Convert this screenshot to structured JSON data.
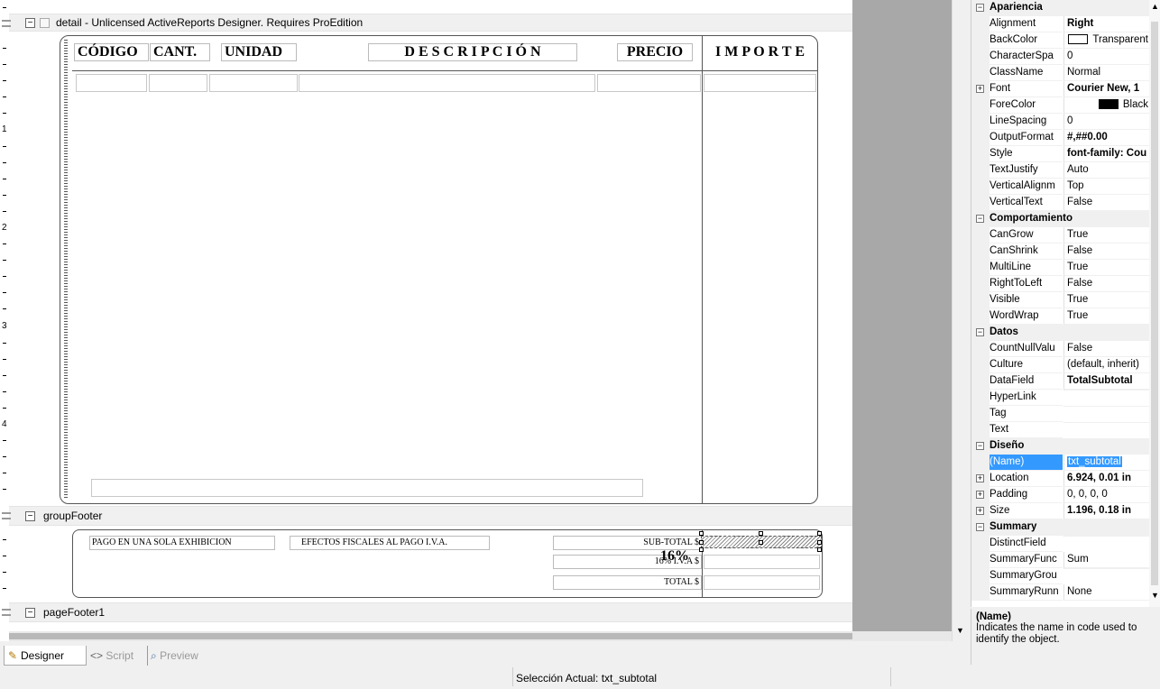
{
  "bands": {
    "detail": {
      "title": "detail  -  Unlicensed ActiveReports Designer. Requires ProEdition"
    },
    "group_footer": {
      "title": "groupFooter"
    },
    "page_footer": {
      "title": "pageFooter1"
    }
  },
  "ruler": {
    "marks": [
      "1",
      "2",
      "3",
      "4"
    ]
  },
  "report": {
    "headers": {
      "codigo": "CÓDIGO",
      "cant": "CANT.",
      "unidad": "UNIDAD",
      "descripcion": "D E S C R I P C I Ó N",
      "precio": "PRECIO",
      "importe": "I M P O R T E"
    },
    "footer": {
      "pago": "PAGO EN UNA SOLA EXHIBICION",
      "efectos": "EFECTOS FISCALES AL PAGO I.V.A.",
      "subtotal": "SUB-TOTAL $",
      "iva": "16% I.V.A $",
      "iva_big": "16%",
      "total": "TOTAL $"
    }
  },
  "properties": {
    "categories": [
      {
        "name": "Apariencia",
        "rows": [
          {
            "name": "Alignment",
            "value": "Right",
            "bold": true
          },
          {
            "name": "BackColor",
            "value": "Transparent",
            "swatch": "#ffffff"
          },
          {
            "name": "CharacterSpa",
            "value": "0"
          },
          {
            "name": "ClassName",
            "value": "Normal"
          },
          {
            "name": "Font",
            "value": "Courier New, 1",
            "bold": true,
            "expand": true
          },
          {
            "name": "ForeColor",
            "value": "Black",
            "swatch": "#000000"
          },
          {
            "name": "LineSpacing",
            "value": "0"
          },
          {
            "name": "OutputFormat",
            "value": "#,##0.00",
            "bold": true
          },
          {
            "name": "Style",
            "value": "font-family: Cou",
            "bold": true
          },
          {
            "name": "TextJustify",
            "value": "Auto"
          },
          {
            "name": "VerticalAlignm",
            "value": "Top"
          },
          {
            "name": "VerticalText",
            "value": "False"
          }
        ]
      },
      {
        "name": "Comportamiento",
        "rows": [
          {
            "name": "CanGrow",
            "value": "True"
          },
          {
            "name": "CanShrink",
            "value": "False"
          },
          {
            "name": "MultiLine",
            "value": "True"
          },
          {
            "name": "RightToLeft",
            "value": "False"
          },
          {
            "name": "Visible",
            "value": "True"
          },
          {
            "name": "WordWrap",
            "value": "True"
          }
        ]
      },
      {
        "name": "Datos",
        "rows": [
          {
            "name": "CountNullValu",
            "value": "False"
          },
          {
            "name": "Culture",
            "value": "(default, inherit)"
          },
          {
            "name": "DataField",
            "value": "TotalSubtotal",
            "bold": true
          },
          {
            "name": "HyperLink",
            "value": ""
          },
          {
            "name": "Tag",
            "value": ""
          },
          {
            "name": "Text",
            "value": ""
          }
        ]
      },
      {
        "name": "Diseño",
        "rows": [
          {
            "name": "(Name)",
            "value": "txt_subtotal",
            "selected": true
          },
          {
            "name": "Location",
            "value": "6.924, 0.01 in",
            "bold": true,
            "expand": true
          },
          {
            "name": "Padding",
            "value": "0, 0, 0, 0",
            "expand": true
          },
          {
            "name": "Size",
            "value": "1.196, 0.18 in",
            "bold": true,
            "expand": true
          }
        ]
      },
      {
        "name": "Summary",
        "rows": [
          {
            "name": "DistinctField",
            "value": ""
          },
          {
            "name": "SummaryFunc",
            "value": "Sum"
          },
          {
            "name": "SummaryGrou",
            "value": ""
          },
          {
            "name": "SummaryRunn",
            "value": "None"
          }
        ]
      }
    ]
  },
  "description": {
    "title": "(Name)",
    "text": "Indicates the name in code used to identify the object."
  },
  "tabs": {
    "designer": "Designer",
    "script": "Script",
    "preview": "Preview"
  },
  "status": {
    "text": "Selección Actual: txt_subtotal"
  },
  "colors": {
    "selection": "#3399ff",
    "category_bg": "#f0f0f0",
    "designer_gray": "#a8a8a8"
  }
}
